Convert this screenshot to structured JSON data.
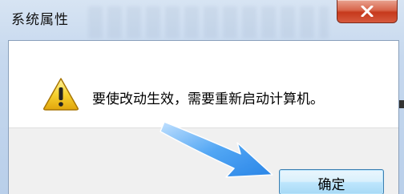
{
  "window": {
    "title": "系统属性"
  },
  "dialog": {
    "message": "要使改动生效，需要重新启动计算机。",
    "icon": "warning-icon",
    "ok_label": "确定"
  },
  "titlebar": {
    "close_icon": "close-icon",
    "close_color": "#c6391c"
  },
  "annotation": {
    "arrow_color": "#2f8cf0"
  }
}
